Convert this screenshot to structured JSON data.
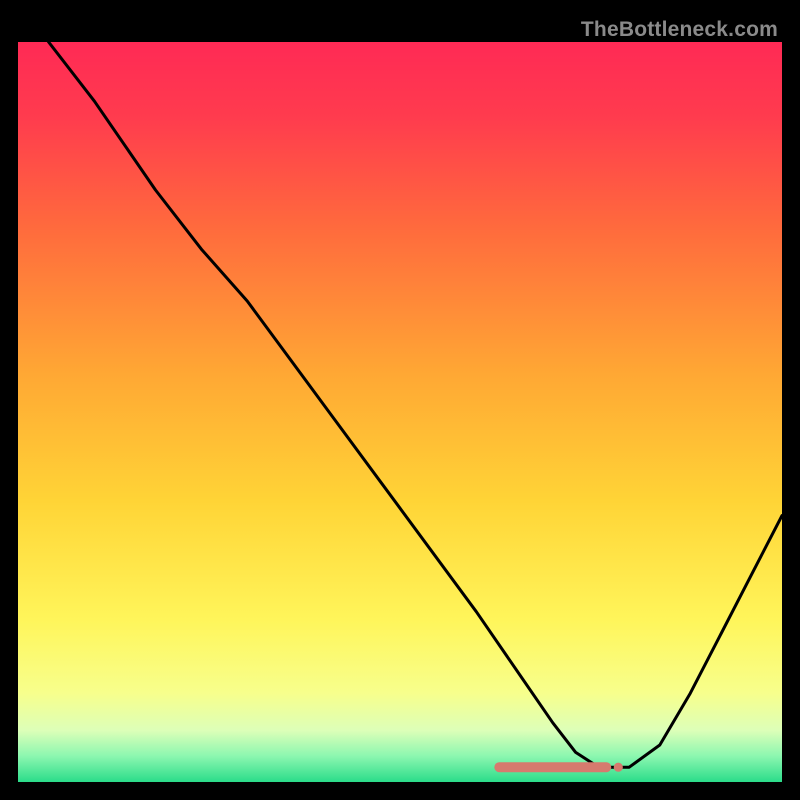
{
  "watermark": "TheBottleneck.com",
  "chart_data": {
    "type": "line",
    "title": "",
    "xlabel": "",
    "ylabel": "",
    "xlim": [
      0,
      100
    ],
    "ylim": [
      0,
      100
    ],
    "grid": false,
    "legend": false,
    "gradient_stops": [
      {
        "offset": 0.0,
        "color": "#ff2a55"
      },
      {
        "offset": 0.1,
        "color": "#ff3b4e"
      },
      {
        "offset": 0.25,
        "color": "#ff6a3d"
      },
      {
        "offset": 0.45,
        "color": "#ffa834"
      },
      {
        "offset": 0.62,
        "color": "#ffd436"
      },
      {
        "offset": 0.78,
        "color": "#fff55a"
      },
      {
        "offset": 0.88,
        "color": "#f7ff8c"
      },
      {
        "offset": 0.93,
        "color": "#ddffb8"
      },
      {
        "offset": 0.965,
        "color": "#8cf7b0"
      },
      {
        "offset": 1.0,
        "color": "#2bdc8a"
      }
    ],
    "series": [
      {
        "name": "bottleneck-curve",
        "color": "#000000",
        "x": [
          4,
          10,
          18,
          24,
          30,
          40,
          50,
          60,
          66,
          70,
          73,
          76,
          80,
          84,
          88,
          92,
          96,
          100
        ],
        "y": [
          100,
          92,
          80,
          72,
          65,
          51,
          37,
          23,
          14,
          8,
          4,
          2,
          2,
          5,
          12,
          20,
          28,
          36
        ]
      }
    ],
    "marker_band": {
      "color": "#d67a6e",
      "x_start": 63,
      "x_end": 77,
      "y": 2,
      "end_dot_radius_pct": 0.6
    }
  }
}
